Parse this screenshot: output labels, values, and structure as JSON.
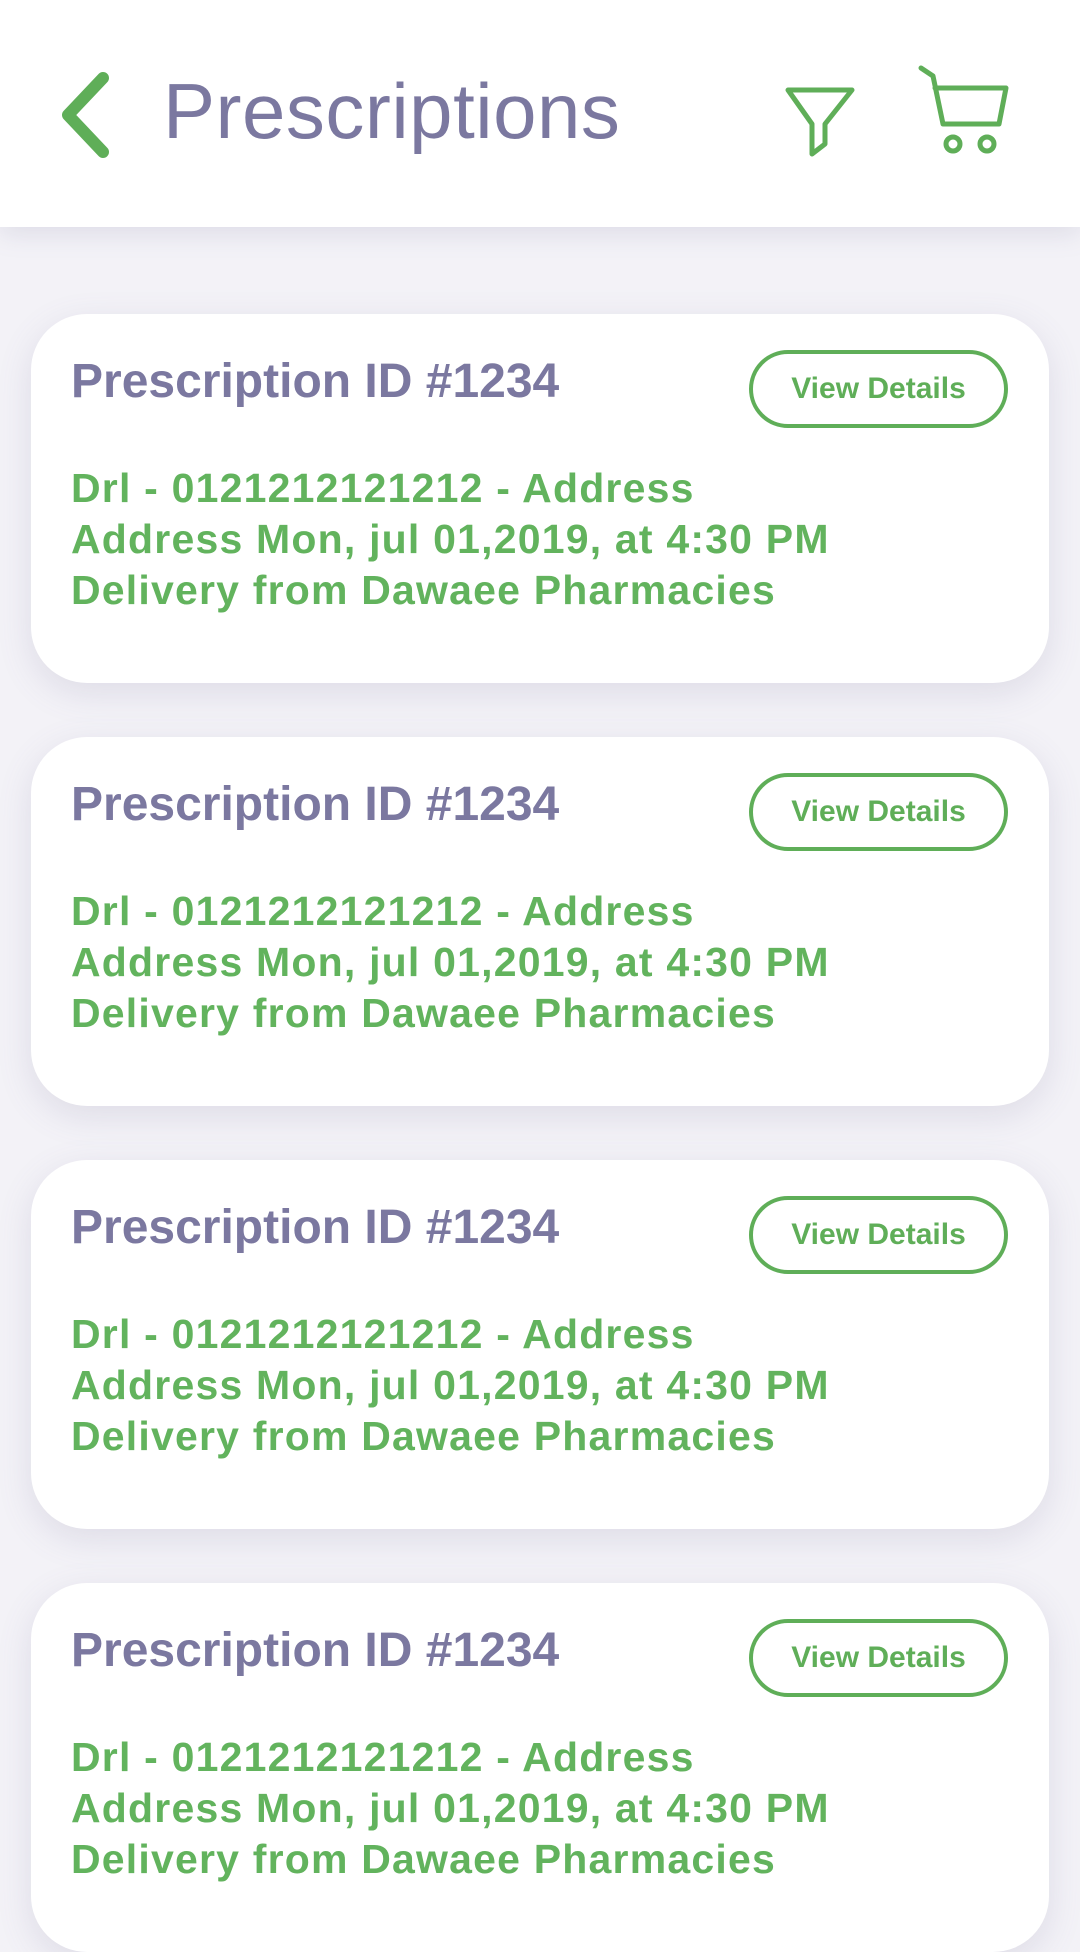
{
  "header": {
    "title": "Prescriptions",
    "back_icon": "chevron-left-icon",
    "filter_icon": "filter-icon",
    "cart_icon": "cart-icon"
  },
  "colors": {
    "title": "#7b78a0",
    "accent_green": "#5fae58",
    "text_green": "#62b35d",
    "background": "#f3f2f7",
    "card": "#ffffff"
  },
  "prescriptions": [
    {
      "title": "Prescription ID #1234",
      "button_label": "View Details",
      "line1": "Drl - 0121212121212 - Address",
      "line2": "Address Mon, jul 01,2019, at 4:30 PM",
      "line3": "Delivery from Dawaee Pharmacies"
    },
    {
      "title": "Prescription ID #1234",
      "button_label": "View Details",
      "line1": "Drl - 0121212121212 - Address",
      "line2": "Address Mon, jul 01,2019, at 4:30 PM",
      "line3": "Delivery from Dawaee Pharmacies"
    },
    {
      "title": "Prescription ID #1234",
      "button_label": "View Details",
      "line1": "Drl - 0121212121212 - Address",
      "line2": "Address Mon, jul 01,2019, at 4:30 PM",
      "line3": "Delivery from Dawaee Pharmacies"
    },
    {
      "title": "Prescription ID #1234",
      "button_label": "View Details",
      "line1": "Drl - 0121212121212 - Address",
      "line2": "Address Mon, jul 01,2019, at 4:30 PM",
      "line3": "Delivery from Dawaee Pharmacies"
    }
  ]
}
